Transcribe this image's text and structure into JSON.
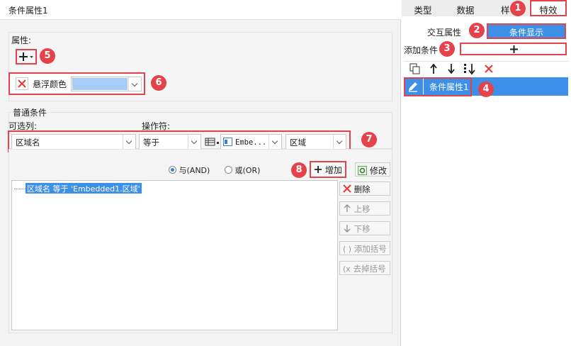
{
  "panel_title": "条件属性1",
  "property_group": {
    "label": "属性:",
    "add_icon": "plus-dropdown-icon",
    "item_label": "悬浮颜色",
    "item_color": "#a6ccf7"
  },
  "normal_cond": {
    "label": "普通条件",
    "optional_label": "可选列:",
    "operator_label": "操作符:",
    "column_value": "区域名",
    "operator_value": "等于",
    "value_text": "Embe...",
    "region_value": "区域"
  },
  "logic": {
    "and_label": "与(AND)",
    "or_label": "或(OR)",
    "add_label": "增加",
    "modify_label": "修改"
  },
  "condition_list": [
    "区域名 等于 'Embedded1.区域'"
  ],
  "side_buttons": {
    "delete": "删除",
    "up": "上移",
    "down": "下移",
    "add_paren": "添加括号",
    "remove_paren": "去掉括号"
  },
  "right_tabs": [
    "类型",
    "数据",
    "样",
    "特效"
  ],
  "subtabs": {
    "interactive": "交互属性",
    "condition_display": "条件显示"
  },
  "add_condition_label": "添加条件",
  "toolbar_icons": [
    "copy-icon",
    "arrow-up-icon",
    "arrow-down-icon",
    "sort-icon",
    "delete-icon"
  ],
  "cond_list": [
    "条件属性1"
  ],
  "badges": [
    "1",
    "2",
    "3",
    "4",
    "5",
    "6",
    "7",
    "8"
  ],
  "colors": {
    "accent": "#3a7be0",
    "highlight_red": "#e5434b",
    "selected_row": "#3d8fe8"
  }
}
